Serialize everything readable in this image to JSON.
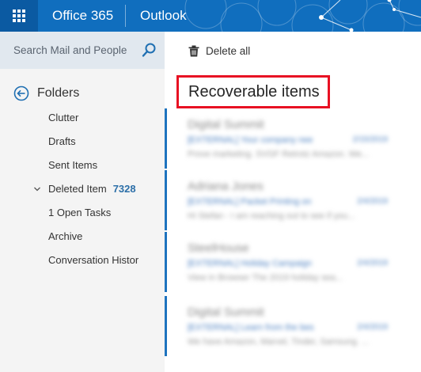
{
  "topbar": {
    "brand": "Office 365",
    "app": "Outlook"
  },
  "search": {
    "placeholder": "Search Mail and People"
  },
  "folders": {
    "title": "Folders",
    "items": [
      {
        "label": "Clutter"
      },
      {
        "label": "Drafts"
      },
      {
        "label": "Sent Items"
      },
      {
        "label": "Deleted Item",
        "count": "7328"
      },
      {
        "label": "1 Open Tasks"
      },
      {
        "label": "Archive"
      },
      {
        "label": "Conversation Histor"
      }
    ]
  },
  "toolbar": {
    "delete_all": "Delete all"
  },
  "main": {
    "title": "Recoverable items",
    "messages": [
      {
        "sender": "Digital Summit",
        "subject": "[EXTERNAL] Your company nee",
        "date": "2/15/2019",
        "preview": "Prove marketing. SVGF Retrotz Amazon. We..."
      },
      {
        "sender": "Adriana Jones",
        "subject": "[EXTERNAL] Packet Printing on",
        "date": "2/4/2019",
        "preview": "Hi Stefan - I am reaching out to see if you..."
      },
      {
        "sender": "SteelHouse",
        "subject": "[EXTERNAL] Holiday Campaign",
        "date": "2/4/2019",
        "preview": "View in Browser        The 2019 holiday sea..."
      },
      {
        "sender": "Digital Summit",
        "subject": "[EXTERNAL] Learn from the bes",
        "date": "2/4/2019",
        "preview": "We have Amazon, Marvel, Tinder, Samsung. ..."
      }
    ]
  },
  "colors": {
    "topbar": "#106ebe",
    "highlight": "#e81123",
    "accent": "#1e73be"
  }
}
